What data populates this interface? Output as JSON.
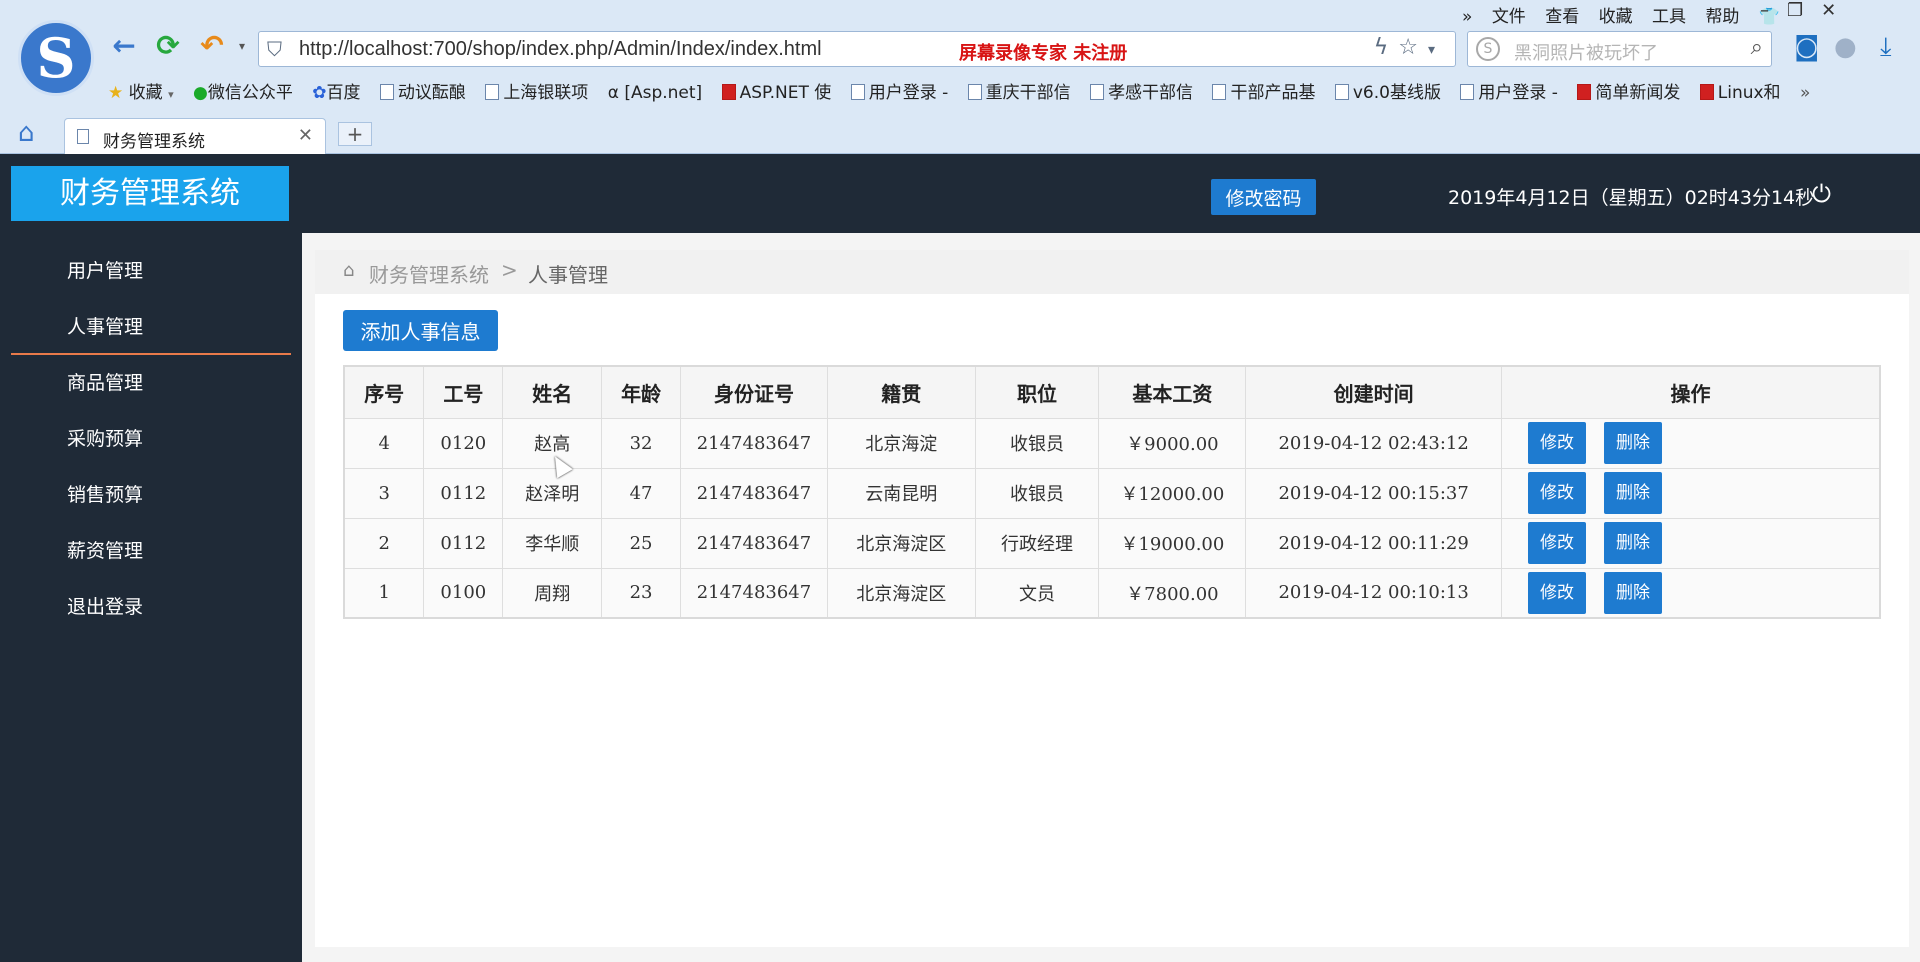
{
  "browser": {
    "logo_letter": "S",
    "url": "http://localhost:700/shop/index.php/Admin/Index/index.html",
    "recorder_notice": "屏幕录像专家   未注册",
    "search_placeholder": "黑洞照片被玩坏了",
    "menu": [
      "文件",
      "查看",
      "收藏",
      "工具",
      "帮助"
    ],
    "bookmarks": [
      {
        "label": "收藏",
        "icon": "star-icon"
      },
      {
        "label": "微信公众平",
        "icon": "wechat-icon"
      },
      {
        "label": "百度",
        "icon": "baidu-icon"
      },
      {
        "label": "动议酝酿",
        "icon": "page-icon"
      },
      {
        "label": "上海银联项",
        "icon": "page-icon"
      },
      {
        "label": "[Asp.net]",
        "icon": "page-icon"
      },
      {
        "label": "ASP.NET 使",
        "icon": "csdn-icon"
      },
      {
        "label": "用户登录 -",
        "icon": "page-icon"
      },
      {
        "label": "重庆干部信",
        "icon": "page-icon"
      },
      {
        "label": "孝感干部信",
        "icon": "page-icon"
      },
      {
        "label": "干部产品基",
        "icon": "page-icon"
      },
      {
        "label": "v6.0基线版",
        "icon": "page-icon"
      },
      {
        "label": "用户登录 -",
        "icon": "page-icon"
      },
      {
        "label": "简单新闻发",
        "icon": "csdn-icon"
      },
      {
        "label": "Linux和",
        "icon": "csdn-icon"
      }
    ],
    "tab_title": "财务管理系统"
  },
  "app": {
    "title": "财务管理系统",
    "change_password": "修改密码",
    "datetime": "2019年4月12日（星期五）02时43分14秒"
  },
  "sidebar": {
    "items": [
      {
        "label": "用户管理",
        "active": false
      },
      {
        "label": "人事管理",
        "active": true
      },
      {
        "label": "商品管理",
        "active": false
      },
      {
        "label": "采购预算",
        "active": false
      },
      {
        "label": "销售预算",
        "active": false
      },
      {
        "label": "薪资管理",
        "active": false
      },
      {
        "label": "退出登录",
        "active": false
      }
    ]
  },
  "breadcrumb": {
    "root": "财务管理系统",
    "separator": ">",
    "current": "人事管理"
  },
  "main": {
    "add_button": "添加人事信息",
    "table": {
      "headers": [
        "序号",
        "工号",
        "姓名",
        "年龄",
        "身份证号",
        "籍贯",
        "职位",
        "基本工资",
        "创建时间",
        "操作"
      ],
      "rows": [
        [
          "4",
          "0120",
          "赵高",
          "32",
          "2147483647",
          "北京海淀",
          "收银员",
          "￥9000.00",
          "2019-04-12 02:43:12"
        ],
        [
          "3",
          "0112",
          "赵泽明",
          "47",
          "2147483647",
          "云南昆明",
          "收银员",
          "￥12000.00",
          "2019-04-12 00:15:37"
        ],
        [
          "2",
          "0112",
          "李华顺",
          "25",
          "2147483647",
          "北京海淀区",
          "行政经理",
          "￥19000.00",
          "2019-04-12 00:11:29"
        ],
        [
          "1",
          "0100",
          "周翔",
          "23",
          "2147483647",
          "北京海淀区",
          "文员",
          "￥7800.00",
          "2019-04-12 00:10:13"
        ]
      ],
      "edit_label": "修改",
      "delete_label": "删除"
    }
  },
  "colors": {
    "header_bg": "#1f2a37",
    "accent_blue": "#1e7bd0",
    "title_blue": "#1aa3ec",
    "active_underline": "#e87a4a"
  }
}
